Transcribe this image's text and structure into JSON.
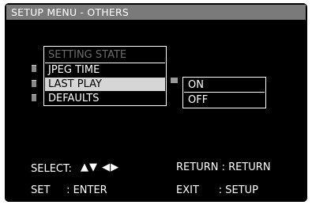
{
  "title": "SETUP MENU - OTHERS",
  "main_menu": {
    "header": "SETTING STATE",
    "items": [
      {
        "label": "JPEG TIME"
      },
      {
        "label": "LAST PLAY"
      },
      {
        "label": "DEFAULTS"
      }
    ],
    "selected": "LAST PLAY"
  },
  "submenu": {
    "options": [
      "ON",
      "OFF"
    ]
  },
  "footer": {
    "select_label": "SELECT:",
    "arrows": "▲▼ ◀▶",
    "return_text": "RETURN : RETURN",
    "set_text": "SET     : ENTER",
    "exit_text": "EXIT      : SETUP"
  },
  "colors": {
    "background": "#000000",
    "title_bar": "#7a7a7a",
    "highlight": "#d6d6d6",
    "text": "#ffffff",
    "disabled_text": "#6c6c6c"
  }
}
